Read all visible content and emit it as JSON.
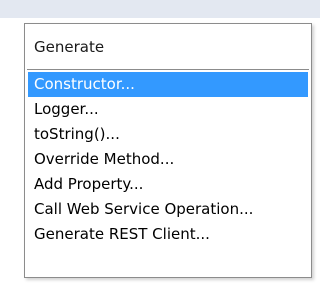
{
  "popup": {
    "title": "Generate",
    "selected_index": 0,
    "items": [
      {
        "label": "Constructor..."
      },
      {
        "label": "Logger..."
      },
      {
        "label": "toString()..."
      },
      {
        "label": "Override Method..."
      },
      {
        "label": "Add Property..."
      },
      {
        "label": "Call Web Service Operation..."
      },
      {
        "label": "Generate REST Client..."
      }
    ]
  },
  "colors": {
    "selection_background": "#3399ff",
    "selection_text": "#ffffff",
    "border": "#8c8c8c",
    "top_strip": "#e3e8f1"
  }
}
